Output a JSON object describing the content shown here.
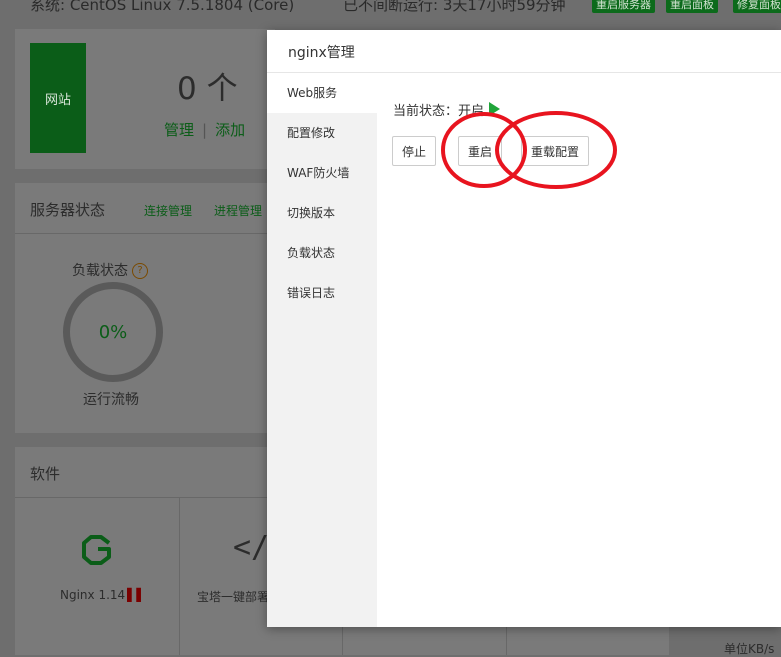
{
  "background": {
    "topbar": {
      "system_text": "系统: CentOS Linux 7.5.1804 (Core)",
      "uptime_text": "已不间断运行: 3天17小时59分钟",
      "buttons": [
        "重启服务器",
        "重启面板",
        "修复面板"
      ]
    },
    "site_card": {
      "tag_label": "网站",
      "count": "0 个",
      "manage_label": "管理",
      "separator": "|",
      "add_label": "添加"
    },
    "server_status": {
      "title": "服务器状态",
      "link_connections": "连接管理",
      "link_processes": "进程管理",
      "load_label": "负载状态",
      "help_icon": "?",
      "load_value": "0%",
      "load_text": "运行流畅"
    },
    "software": {
      "title": "软件",
      "items": [
        {
          "name": "Nginx 1.14",
          "icon": "nginx-logo"
        },
        {
          "name": "宝塔一键部署",
          "icon": "code-icon"
        }
      ]
    },
    "speed_unit": "单位KB/s"
  },
  "modal": {
    "title": "nginx管理",
    "nav": [
      {
        "label": "Web服务",
        "active": true
      },
      {
        "label": "配置修改",
        "active": false
      },
      {
        "label": "WAF防火墙",
        "active": false
      },
      {
        "label": "切换版本",
        "active": false
      },
      {
        "label": "负载状态",
        "active": false
      },
      {
        "label": "错误日志",
        "active": false
      }
    ],
    "status_text": "当前状态：开启",
    "status_icon": "play-icon",
    "status_color": "#20a53a",
    "buttons": {
      "stop": "停止",
      "restart": "重启",
      "reload": "重载配置"
    }
  },
  "colors": {
    "accent_green": "#20a53a",
    "annotation_red": "#e8141f"
  }
}
